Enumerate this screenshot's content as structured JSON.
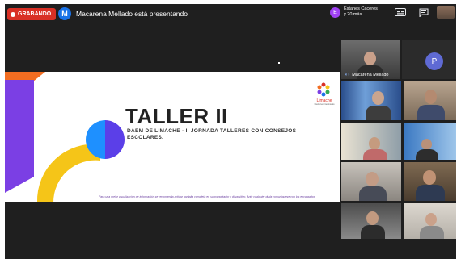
{
  "topbar": {
    "recording_label": "GRABANDO",
    "presenter_initial": "M",
    "presenter_text": "Macarena Mellado está presentando",
    "participant_initial": "E",
    "participant_name": "Estanes Caceres",
    "participant_more": "y 20 más",
    "icons": [
      "captions-icon",
      "chat-icon"
    ]
  },
  "slide": {
    "title": "TALLER II",
    "subtitle": "DAEM DE LIMACHE - II JORNADA TALLERES CON CONSEJOS ESCOLARES.",
    "logo_text": "Limache",
    "logo_tagline": "Ciudad en crecimiento",
    "footer": "Para una mejor visualización de información se recomienda activar pantalla completa en su computador y dispositivo. Ante cualquier duda comuníquese con los encargados"
  },
  "tiles": {
    "active_speaker_name": "Macarena Mellado",
    "placeholder_initial": "P"
  },
  "colors": {
    "recording": "#d93025",
    "accent_blue": "#1a73e8",
    "slide_purple": "#7b3fe4",
    "slide_yellow": "#f5c518",
    "slide_orange": "#f26d21"
  }
}
